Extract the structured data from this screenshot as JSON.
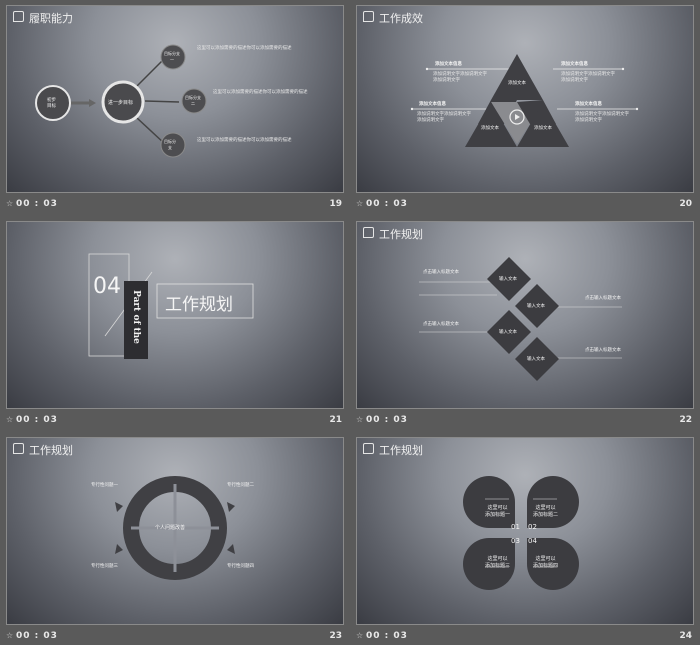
{
  "slides": [
    {
      "num": "19",
      "time": "00 : 03",
      "title": "履职能力",
      "nodes": {
        "left": "初步\n目标",
        "center": "进一步目标",
        "top": "目标分支\n一",
        "mid": "目标分支\n二",
        "bottom": "目标分\n支"
      },
      "notes": [
        "这里可以添加需要的描述你可以添加需要的描述",
        "这里可以添加需要的描述你可以添加需要的描述",
        "这里可以添加需要的描述你可以添加需要的描述"
      ]
    },
    {
      "num": "20",
      "time": "00 : 03",
      "title": "工作成效",
      "heads": [
        "添加文本信息",
        "添加文本信息",
        "添加文本信息",
        "添加文本信息"
      ],
      "tri": [
        "添加文本",
        "添加文本",
        "添加文本"
      ],
      "body": "添加说明文字添加说明文字添加说明文字"
    },
    {
      "num": "21",
      "time": "00 : 03",
      "number": "04",
      "part": "Part of the",
      "title": "工作规划"
    },
    {
      "num": "22",
      "time": "00 : 03",
      "title": "工作规划",
      "diamonds": [
        "输入文本",
        "输入文本",
        "输入文本",
        "输入文本"
      ],
      "heads": [
        "点击输入标题文本",
        "点击输入标题文本",
        "点击输入标题文本",
        "点击输入标题文本"
      ]
    },
    {
      "num": "23",
      "time": "00 : 03",
      "title": "工作规划",
      "center": "个人问题改善",
      "heads": [
        "专行性问题一",
        "专行性问题二",
        "专行性问题三",
        "专行性问题四"
      ]
    },
    {
      "num": "24",
      "time": "00 : 03",
      "title": "工作规划",
      "petals": [
        "这里可以\n添加标题一",
        "这里可以\n添加标题二",
        "这里可以\n添加标题三",
        "这里可以\n添加标题四"
      ],
      "nums": [
        "01",
        "02",
        "03",
        "04"
      ]
    }
  ]
}
